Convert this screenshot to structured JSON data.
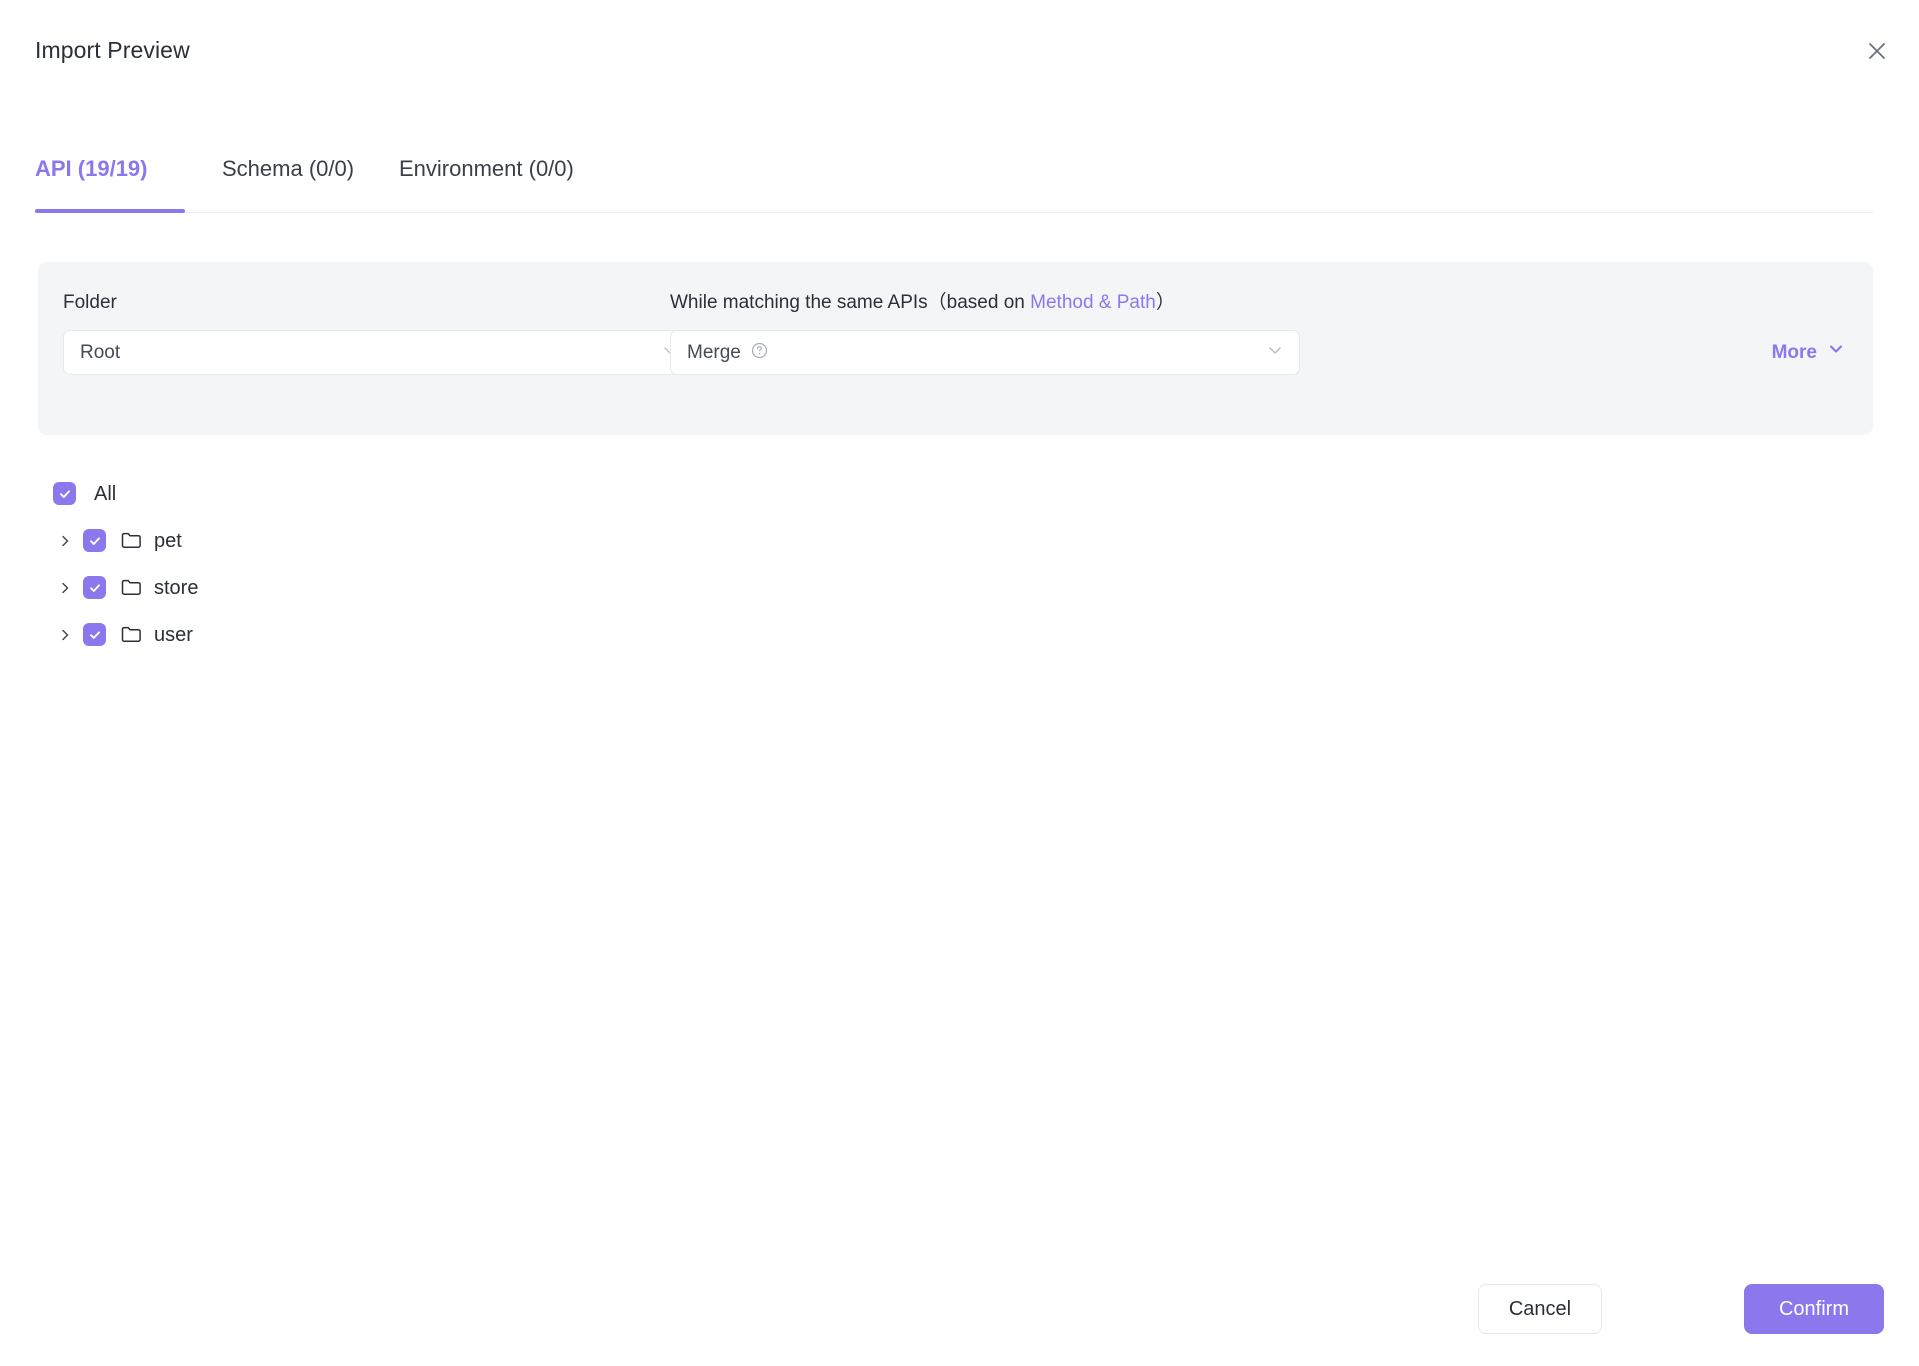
{
  "dialog": {
    "title": "Import Preview",
    "close_icon": "close-icon"
  },
  "tabs": {
    "active_index": 0,
    "items": [
      {
        "label": "API (19/19)"
      },
      {
        "label": "Schema (0/0)"
      },
      {
        "label": "Environment (0/0)"
      }
    ]
  },
  "settings": {
    "folder": {
      "label": "Folder",
      "value": "Root",
      "arrow_icon": "chevron-down-icon"
    },
    "matching": {
      "label_main": "While matching the same APIs",
      "label_paren_open": "（based on ",
      "label_accent": "Method & Path",
      "label_paren_close": "）",
      "value": "Merge",
      "help_icon": "help-circle-icon",
      "arrow_icon": "chevron-down-icon"
    },
    "more": {
      "label": "More",
      "icon": "chevron-down-icon"
    }
  },
  "tree": {
    "rows": [
      {
        "label": "All",
        "level": 0,
        "checked": true,
        "expandable": false,
        "icon": null
      },
      {
        "label": "pet",
        "level": 1,
        "checked": true,
        "expandable": true,
        "icon": "folder-icon"
      },
      {
        "label": "store",
        "level": 1,
        "checked": true,
        "expandable": true,
        "icon": "folder-icon"
      },
      {
        "label": "user",
        "level": 1,
        "checked": true,
        "expandable": true,
        "icon": "folder-icon"
      }
    ]
  },
  "footer": {
    "cancel_label": "Cancel",
    "confirm_label": "Confirm"
  },
  "colors": {
    "accent": "#8d77ec",
    "panel_bg": "#f4f5f7",
    "text": "#2b2f38",
    "border": "#e7e8ec"
  }
}
